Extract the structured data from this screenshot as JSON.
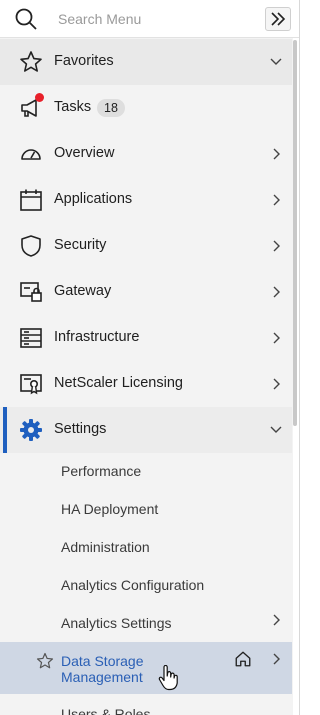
{
  "search": {
    "placeholder": "Search Menu"
  },
  "menu": [
    {
      "label": "Favorites",
      "icon": "star-icon"
    },
    {
      "label": "Tasks",
      "icon": "megaphone-icon",
      "badge": "18"
    },
    {
      "label": "Overview",
      "icon": "gauge-icon"
    },
    {
      "label": "Applications",
      "icon": "calendar-icon"
    },
    {
      "label": "Security",
      "icon": "shield-icon"
    },
    {
      "label": "Gateway",
      "icon": "gateway-lock-icon"
    },
    {
      "label": "Infrastructure",
      "icon": "server-rack-icon"
    },
    {
      "label": "NetScaler Licensing",
      "icon": "certificate-icon"
    },
    {
      "label": "Settings",
      "icon": "gear-icon"
    }
  ],
  "settings_sub": [
    {
      "label": "Performance"
    },
    {
      "label": "HA Deployment"
    },
    {
      "label": "Administration"
    },
    {
      "label": "Analytics Configuration"
    },
    {
      "label": "Analytics Settings"
    },
    {
      "label": "Data Storage Management"
    },
    {
      "label": "Users & Roles"
    }
  ],
  "colors": {
    "accent": "#1f5fbf",
    "notification": "#e8202a",
    "active_sub_bg": "#cfd7e4"
  }
}
